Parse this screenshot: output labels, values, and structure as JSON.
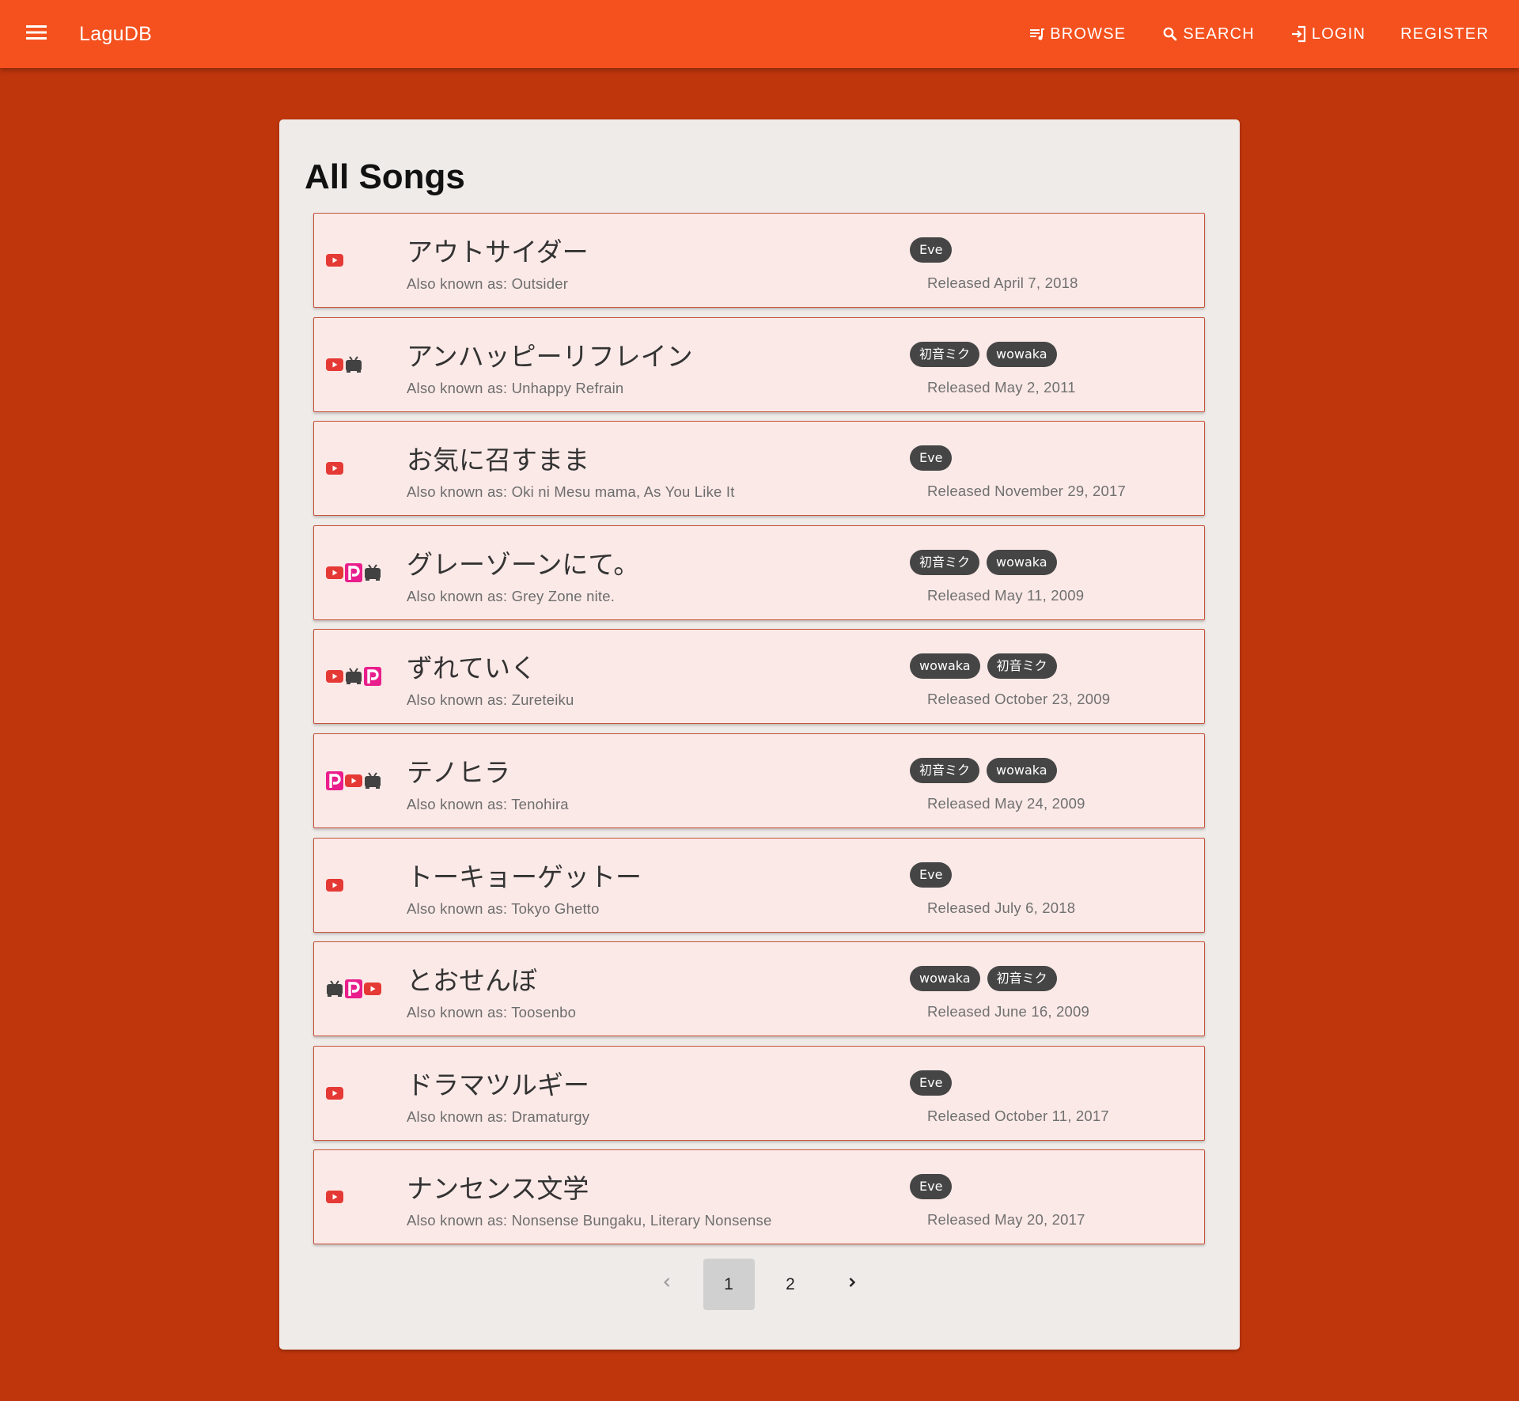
{
  "appbar": {
    "brand": "LaguDB",
    "nav": {
      "browse": "BROWSE",
      "search": "SEARCH",
      "login": "LOGIN",
      "register": "REGISTER"
    }
  },
  "page": {
    "title": "All Songs"
  },
  "songs": [
    {
      "title": "アウトサイダー",
      "aka": "Also known as: Outsider",
      "artists": [
        "Eve"
      ],
      "released": "Released April 7, 2018",
      "platforms": [
        "youtube"
      ]
    },
    {
      "title": "アンハッピーリフレイン",
      "aka": "Also known as: Unhappy Refrain",
      "artists": [
        "初音ミク",
        "wowaka"
      ],
      "released": "Released May 2, 2011",
      "platforms": [
        "youtube",
        "niconico"
      ]
    },
    {
      "title": "お気に召すまま",
      "aka": "Also known as: Oki ni Mesu mama, As You Like It",
      "artists": [
        "Eve"
      ],
      "released": "Released November 29, 2017",
      "platforms": [
        "youtube"
      ]
    },
    {
      "title": "グレーゾーンにて。",
      "aka": "Also known as: Grey Zone nite.",
      "artists": [
        "初音ミク",
        "wowaka"
      ],
      "released": "Released May 11, 2009",
      "platforms": [
        "youtube",
        "piapro",
        "niconico"
      ]
    },
    {
      "title": "ずれていく",
      "aka": "Also known as: Zureteiku",
      "artists": [
        "wowaka",
        "初音ミク"
      ],
      "released": "Released October 23, 2009",
      "platforms": [
        "youtube",
        "niconico",
        "piapro"
      ]
    },
    {
      "title": "テノヒラ",
      "aka": "Also known as: Tenohira",
      "artists": [
        "初音ミク",
        "wowaka"
      ],
      "released": "Released May 24, 2009",
      "platforms": [
        "piapro",
        "youtube",
        "niconico"
      ]
    },
    {
      "title": "トーキョーゲットー",
      "aka": "Also known as: Tokyo Ghetto",
      "artists": [
        "Eve"
      ],
      "released": "Released July 6, 2018",
      "platforms": [
        "youtube"
      ]
    },
    {
      "title": "とおせんぼ",
      "aka": "Also known as: Toosenbo",
      "artists": [
        "wowaka",
        "初音ミク"
      ],
      "released": "Released June 16, 2009",
      "platforms": [
        "niconico",
        "piapro",
        "youtube"
      ]
    },
    {
      "title": "ドラマツルギー",
      "aka": "Also known as: Dramaturgy",
      "artists": [
        "Eve"
      ],
      "released": "Released October 11, 2017",
      "platforms": [
        "youtube"
      ]
    },
    {
      "title": "ナンセンス文学",
      "aka": "Also known as: Nonsense Bungaku, Literary Nonsense",
      "artists": [
        "Eve"
      ],
      "released": "Released May 20, 2017",
      "platforms": [
        "youtube"
      ]
    }
  ],
  "pagination": {
    "prev_icon": "chevron-left-icon",
    "pages": [
      "1",
      "2"
    ],
    "current": "1",
    "next_icon": "chevron-right-icon"
  },
  "colors": {
    "appbar": "#f4511e",
    "background": "#bf360c",
    "card": "#efebe9",
    "item": "#fbe9e7",
    "chip": "#454545",
    "youtube": "#e53935",
    "piapro": "#e91e8c",
    "niconico": "#424242"
  }
}
